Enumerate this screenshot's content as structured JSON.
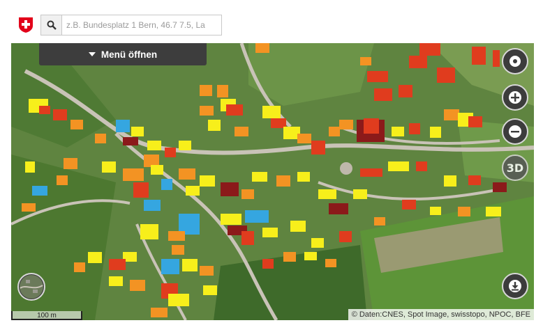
{
  "search": {
    "placeholder": "z.B. Bundesplatz 1 Bern, 46.7 7.5, La"
  },
  "menu": {
    "label": "Menü öffnen"
  },
  "controls": {
    "three_d_label": "3D"
  },
  "map": {
    "attribution": "© Daten:CNES, Spot Image, swisstopo, NPOC, BFE",
    "scale_label": "100 m",
    "roof_colors": {
      "excellent": "#8b1a1a",
      "very_good": "#e03c1e",
      "good": "#f39323",
      "medium": "#f7ef1b",
      "low": "#35a6e0"
    }
  },
  "icons": [
    "swiss-cross-icon",
    "search-icon",
    "caret-down-icon",
    "locate-icon",
    "zoom-in-icon",
    "zoom-out-icon",
    "3d-icon",
    "print-icon",
    "background-layer-icon"
  ]
}
